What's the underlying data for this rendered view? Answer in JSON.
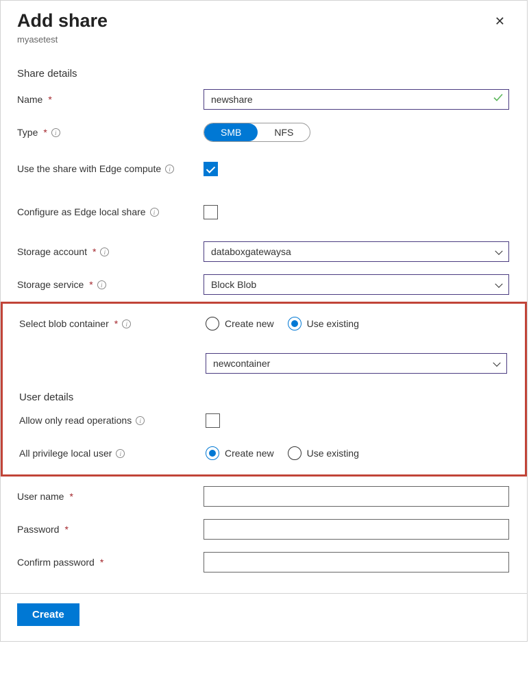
{
  "header": {
    "title": "Add share",
    "subtitle": "myasetest"
  },
  "sections": {
    "shareDetails": "Share details",
    "userDetails": "User details"
  },
  "fields": {
    "name": {
      "label": "Name",
      "value": "newshare"
    },
    "type": {
      "label": "Type",
      "options": [
        "SMB",
        "NFS"
      ],
      "selected": "SMB"
    },
    "edgeCompute": {
      "label": "Use the share with Edge compute",
      "checked": true
    },
    "edgeLocal": {
      "label": "Configure as Edge local share",
      "checked": false
    },
    "storageAccount": {
      "label": "Storage account",
      "value": "databoxgatewaysa"
    },
    "storageService": {
      "label": "Storage service",
      "value": "Block Blob"
    },
    "blobContainer": {
      "label": "Select blob container",
      "options": {
        "createNew": "Create new",
        "useExisting": "Use existing"
      },
      "selected": "useExisting",
      "value": "newcontainer"
    },
    "readOnly": {
      "label": "Allow only read operations",
      "checked": false
    },
    "privilegeUser": {
      "label": "All privilege local user",
      "options": {
        "createNew": "Create new",
        "useExisting": "Use existing"
      },
      "selected": "createNew"
    },
    "userName": {
      "label": "User name",
      "value": ""
    },
    "password": {
      "label": "Password",
      "value": ""
    },
    "confirmPassword": {
      "label": "Confirm password",
      "value": ""
    }
  },
  "footer": {
    "create": "Create"
  }
}
